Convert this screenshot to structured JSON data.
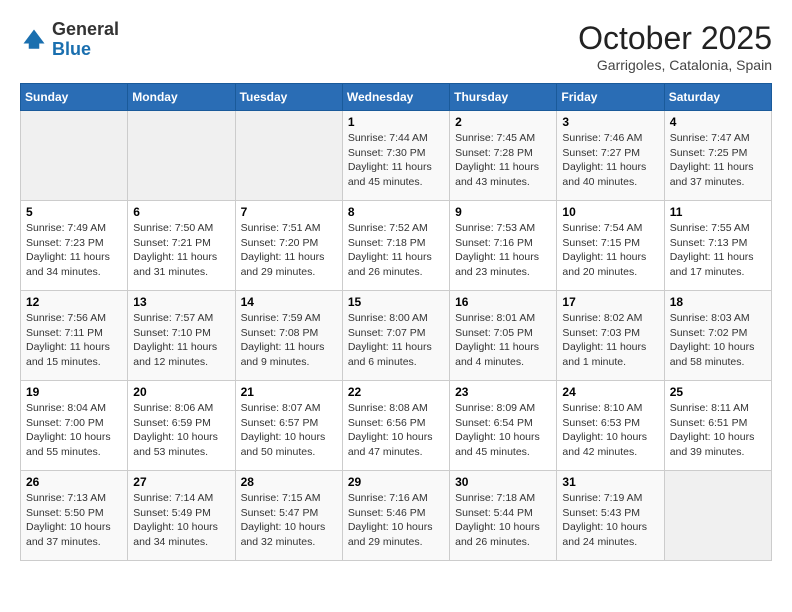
{
  "header": {
    "logo_general": "General",
    "logo_blue": "Blue",
    "month": "October 2025",
    "location": "Garrigoles, Catalonia, Spain"
  },
  "weekdays": [
    "Sunday",
    "Monday",
    "Tuesday",
    "Wednesday",
    "Thursday",
    "Friday",
    "Saturday"
  ],
  "weeks": [
    [
      {
        "day": "",
        "info": ""
      },
      {
        "day": "",
        "info": ""
      },
      {
        "day": "",
        "info": ""
      },
      {
        "day": "1",
        "info": "Sunrise: 7:44 AM\nSunset: 7:30 PM\nDaylight: 11 hours\nand 45 minutes."
      },
      {
        "day": "2",
        "info": "Sunrise: 7:45 AM\nSunset: 7:28 PM\nDaylight: 11 hours\nand 43 minutes."
      },
      {
        "day": "3",
        "info": "Sunrise: 7:46 AM\nSunset: 7:27 PM\nDaylight: 11 hours\nand 40 minutes."
      },
      {
        "day": "4",
        "info": "Sunrise: 7:47 AM\nSunset: 7:25 PM\nDaylight: 11 hours\nand 37 minutes."
      }
    ],
    [
      {
        "day": "5",
        "info": "Sunrise: 7:49 AM\nSunset: 7:23 PM\nDaylight: 11 hours\nand 34 minutes."
      },
      {
        "day": "6",
        "info": "Sunrise: 7:50 AM\nSunset: 7:21 PM\nDaylight: 11 hours\nand 31 minutes."
      },
      {
        "day": "7",
        "info": "Sunrise: 7:51 AM\nSunset: 7:20 PM\nDaylight: 11 hours\nand 29 minutes."
      },
      {
        "day": "8",
        "info": "Sunrise: 7:52 AM\nSunset: 7:18 PM\nDaylight: 11 hours\nand 26 minutes."
      },
      {
        "day": "9",
        "info": "Sunrise: 7:53 AM\nSunset: 7:16 PM\nDaylight: 11 hours\nand 23 minutes."
      },
      {
        "day": "10",
        "info": "Sunrise: 7:54 AM\nSunset: 7:15 PM\nDaylight: 11 hours\nand 20 minutes."
      },
      {
        "day": "11",
        "info": "Sunrise: 7:55 AM\nSunset: 7:13 PM\nDaylight: 11 hours\nand 17 minutes."
      }
    ],
    [
      {
        "day": "12",
        "info": "Sunrise: 7:56 AM\nSunset: 7:11 PM\nDaylight: 11 hours\nand 15 minutes."
      },
      {
        "day": "13",
        "info": "Sunrise: 7:57 AM\nSunset: 7:10 PM\nDaylight: 11 hours\nand 12 minutes."
      },
      {
        "day": "14",
        "info": "Sunrise: 7:59 AM\nSunset: 7:08 PM\nDaylight: 11 hours\nand 9 minutes."
      },
      {
        "day": "15",
        "info": "Sunrise: 8:00 AM\nSunset: 7:07 PM\nDaylight: 11 hours\nand 6 minutes."
      },
      {
        "day": "16",
        "info": "Sunrise: 8:01 AM\nSunset: 7:05 PM\nDaylight: 11 hours\nand 4 minutes."
      },
      {
        "day": "17",
        "info": "Sunrise: 8:02 AM\nSunset: 7:03 PM\nDaylight: 11 hours\nand 1 minute."
      },
      {
        "day": "18",
        "info": "Sunrise: 8:03 AM\nSunset: 7:02 PM\nDaylight: 10 hours\nand 58 minutes."
      }
    ],
    [
      {
        "day": "19",
        "info": "Sunrise: 8:04 AM\nSunset: 7:00 PM\nDaylight: 10 hours\nand 55 minutes."
      },
      {
        "day": "20",
        "info": "Sunrise: 8:06 AM\nSunset: 6:59 PM\nDaylight: 10 hours\nand 53 minutes."
      },
      {
        "day": "21",
        "info": "Sunrise: 8:07 AM\nSunset: 6:57 PM\nDaylight: 10 hours\nand 50 minutes."
      },
      {
        "day": "22",
        "info": "Sunrise: 8:08 AM\nSunset: 6:56 PM\nDaylight: 10 hours\nand 47 minutes."
      },
      {
        "day": "23",
        "info": "Sunrise: 8:09 AM\nSunset: 6:54 PM\nDaylight: 10 hours\nand 45 minutes."
      },
      {
        "day": "24",
        "info": "Sunrise: 8:10 AM\nSunset: 6:53 PM\nDaylight: 10 hours\nand 42 minutes."
      },
      {
        "day": "25",
        "info": "Sunrise: 8:11 AM\nSunset: 6:51 PM\nDaylight: 10 hours\nand 39 minutes."
      }
    ],
    [
      {
        "day": "26",
        "info": "Sunrise: 7:13 AM\nSunset: 5:50 PM\nDaylight: 10 hours\nand 37 minutes."
      },
      {
        "day": "27",
        "info": "Sunrise: 7:14 AM\nSunset: 5:49 PM\nDaylight: 10 hours\nand 34 minutes."
      },
      {
        "day": "28",
        "info": "Sunrise: 7:15 AM\nSunset: 5:47 PM\nDaylight: 10 hours\nand 32 minutes."
      },
      {
        "day": "29",
        "info": "Sunrise: 7:16 AM\nSunset: 5:46 PM\nDaylight: 10 hours\nand 29 minutes."
      },
      {
        "day": "30",
        "info": "Sunrise: 7:18 AM\nSunset: 5:44 PM\nDaylight: 10 hours\nand 26 minutes."
      },
      {
        "day": "31",
        "info": "Sunrise: 7:19 AM\nSunset: 5:43 PM\nDaylight: 10 hours\nand 24 minutes."
      },
      {
        "day": "",
        "info": ""
      }
    ]
  ]
}
